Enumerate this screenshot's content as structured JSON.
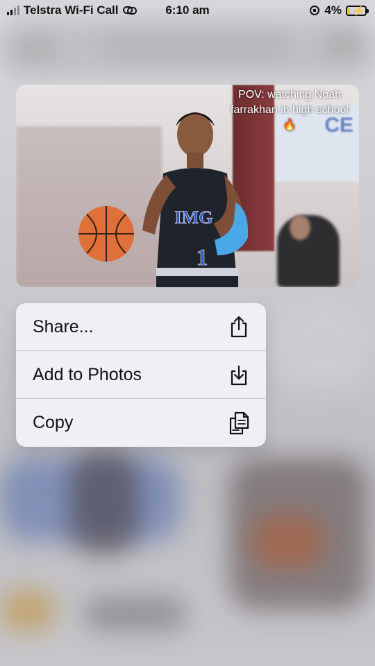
{
  "status_bar": {
    "carrier": "Telstra Wi-Fi Call",
    "time": "6:10 am",
    "battery_percent": "4%",
    "battery_level": 0.04
  },
  "preview": {
    "caption_line1": "POV: watching Noah",
    "caption_line2": "farrakhan in high school",
    "caption_emoji": "🔥",
    "jersey_text": "IMG",
    "jersey_number": "1",
    "banner_text": "CE"
  },
  "menu": {
    "items": [
      {
        "label": "Share...",
        "icon": "share-icon"
      },
      {
        "label": "Add to Photos",
        "icon": "add-to-photos-icon"
      },
      {
        "label": "Copy",
        "icon": "copy-icon"
      }
    ]
  },
  "colors": {
    "menu_bg": "#f0eff3",
    "battery_fill": "#f4c400",
    "jersey": "#1f232b",
    "sleeve": "#4aa8e6"
  }
}
